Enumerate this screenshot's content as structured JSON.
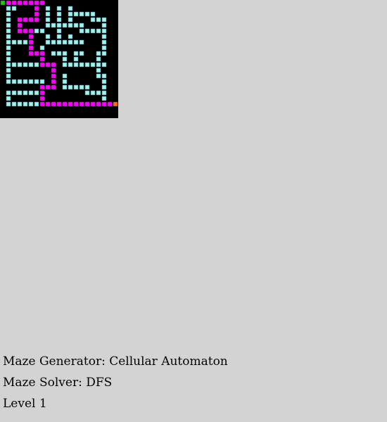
{
  "maze": {
    "grid_size": 21,
    "grid": [
      "SPPPPPPPWWWWWWWWWWWWW",
      "WCCWWWPWCWCWCWWWWWWWW",
      "WCWWWWPWCWCWCCCCCWWWW",
      "WCWPPPPWCWCWCWWWCCCWW",
      "WCWPWWWWCCCCCCCWWWCWW",
      "WCWPPPCCWWCWWWCCCCCWW",
      "WCWWWPWWCWCWCWWWWWCWW",
      "WCCCCPWWCCCCCCCWWWCWW",
      "WCWWWPWCWWWWWWWWWWCWW",
      "WCWWWPPPWCCCWCCWWCCWW",
      "WCWWWWWPWWWCWCWWWCWWW",
      "WCCCCCCPPPWCCCCCCCCWW",
      "WCWWWWWWWPWWWWWWWCWWW",
      "WCWWWWWWWPWCWWWWWCCWW",
      "WCCCCCCCWPWCWWWWWWCWW",
      "WWWWWWWPPPWCCCCCWWCWW",
      "WCCCCCCPWWWWWWWCCCCWW",
      "WCWWWWWPWWWWWWWWWWCWW",
      "WCCCCCCPPPPPPPPPPPPPE",
      "WWWWWWWWWWWWWWWWWWWWW",
      "WWWWWWWWWWWWWWWWWWWWW"
    ],
    "colors": {
      "wall": "#000000",
      "open": "#ffffff",
      "visited": "#a0f0f0",
      "path": "#ff00ff",
      "start": "#22c322",
      "end": "#ff6a1a"
    }
  },
  "info": {
    "generator": "Maze Generator: Cellular Automaton",
    "solver": "Maze Solver: DFS",
    "level": "Level 1"
  }
}
